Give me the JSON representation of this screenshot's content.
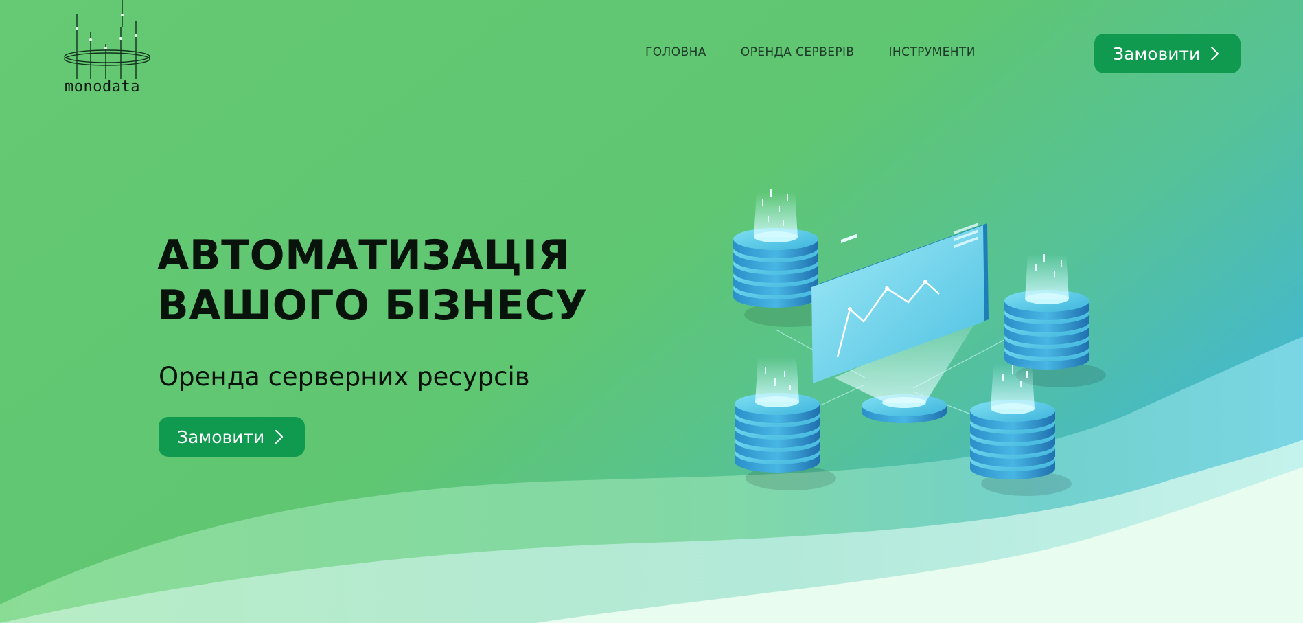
{
  "brand": {
    "name": "monodata"
  },
  "nav": {
    "items": [
      {
        "label": "ГОЛОВНА"
      },
      {
        "label": "ОРЕНДА СЕРВЕРІВ"
      },
      {
        "label": "ІНСТРУМЕНТИ"
      }
    ]
  },
  "header": {
    "order_label": "Замовити"
  },
  "hero": {
    "title_line1": "АВТОМАТИЗАЦІЯ",
    "title_line2": "ВАШОГО БІЗНЕСУ",
    "subtitle": "Оренда серверних ресурсів",
    "order_label": "Замовити"
  },
  "colors": {
    "accent": "#0f9a50",
    "background_green": "#62c66f",
    "background_teal": "#4bbcc9",
    "wave_light": "#e6fbee"
  },
  "icons": [
    "logo-bars-icon",
    "chevron-right-icon",
    "server-stack-icon",
    "dashboard-chart-icon"
  ]
}
